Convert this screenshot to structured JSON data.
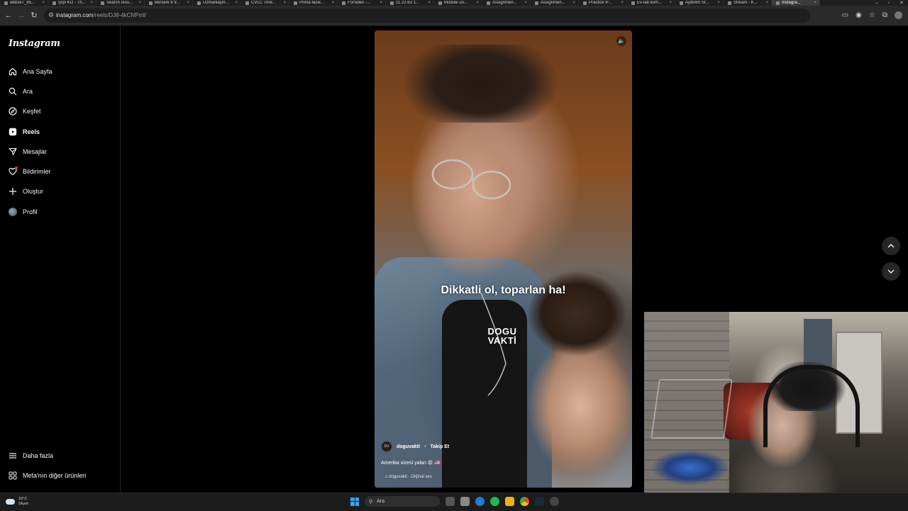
{
  "browser": {
    "tabs": [
      {
        "title": "a883e7_85..."
      },
      {
        "title": "Şişli Kız - Th..."
      },
      {
        "title": "Search resu..."
      },
      {
        "title": "Berserk 8 9..."
      },
      {
        "title": "Uzmanlaşm..."
      },
      {
        "title": "CVLC Thre..."
      },
      {
        "title": "Prima facie..."
      },
      {
        "title": "Forsiden -..."
      },
      {
        "title": "11.22.63 1..."
      },
      {
        "title": "Module un..."
      },
      {
        "title": "Assignmen..."
      },
      {
        "title": "Assignmen..."
      },
      {
        "title": "Practice IF..."
      },
      {
        "title": "Ev-lab korri..."
      },
      {
        "title": "Aydinim St..."
      },
      {
        "title": "Stream - K..."
      },
      {
        "title": "Instagra..."
      }
    ],
    "url_host": "instagram.com",
    "url_path": "/reels/DJ8-4kCNPml/"
  },
  "sidebar": {
    "logo": "Instagram",
    "items": [
      {
        "label": "Ana Sayfa",
        "icon": "home-icon"
      },
      {
        "label": "Ara",
        "icon": "search-icon"
      },
      {
        "label": "Keşfet",
        "icon": "compass-icon"
      },
      {
        "label": "Reels",
        "icon": "reels-icon"
      },
      {
        "label": "Mesajlar",
        "icon": "messages-icon"
      },
      {
        "label": "Bildirimler",
        "icon": "heart-icon"
      },
      {
        "label": "Oluştur",
        "icon": "plus-icon"
      },
      {
        "label": "Profil",
        "icon": "avatar"
      }
    ],
    "bottom": [
      {
        "label": "Daha fazla",
        "icon": "menu-icon"
      },
      {
        "label": "Meta'nın diğer ürünleri",
        "icon": "meta-icon"
      }
    ]
  },
  "reel": {
    "subtitle": "Dikkatli ol, toparlan ha!",
    "watermark_line1": "DOGU",
    "watermark_line2": "VAKTİ",
    "author": "doguvakti",
    "author_avatar_text": "DV",
    "separator": "•",
    "follow": "Takip Et",
    "caption": "Amerika vizesi yalan 😡 🇺🇸",
    "audio": "doguvakti · Orijinal ses"
  },
  "taskbar": {
    "temperature": "10°C",
    "weather": "Skyet",
    "search_placeholder": "Ara"
  },
  "colors": {
    "background": "#000000",
    "sidebar_border": "#262626",
    "notification": "#ff3040",
    "windows_blue": "#3ba3f0"
  }
}
